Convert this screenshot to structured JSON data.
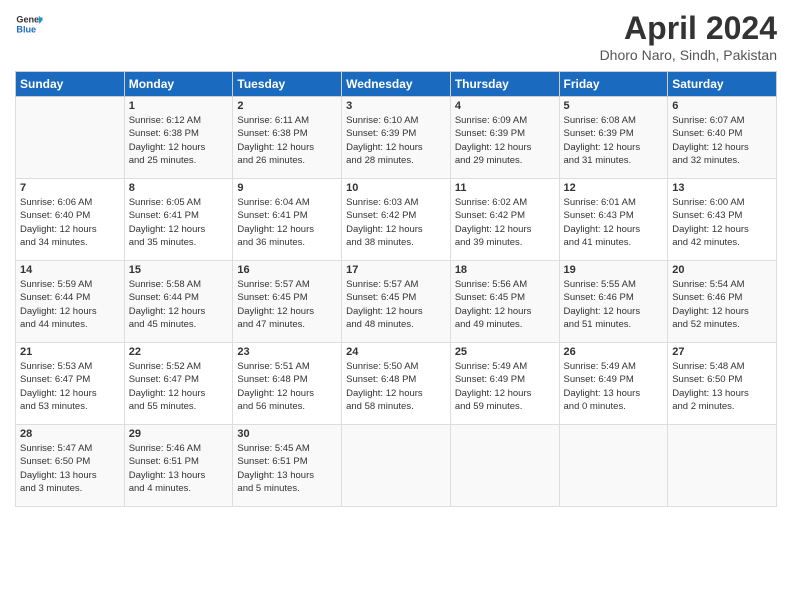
{
  "header": {
    "logo_line1": "General",
    "logo_line2": "Blue",
    "title": "April 2024",
    "location": "Dhoro Naro, Sindh, Pakistan"
  },
  "columns": [
    "Sunday",
    "Monday",
    "Tuesday",
    "Wednesday",
    "Thursday",
    "Friday",
    "Saturday"
  ],
  "rows": [
    [
      {
        "day": "",
        "info": ""
      },
      {
        "day": "1",
        "info": "Sunrise: 6:12 AM\nSunset: 6:38 PM\nDaylight: 12 hours\nand 25 minutes."
      },
      {
        "day": "2",
        "info": "Sunrise: 6:11 AM\nSunset: 6:38 PM\nDaylight: 12 hours\nand 26 minutes."
      },
      {
        "day": "3",
        "info": "Sunrise: 6:10 AM\nSunset: 6:39 PM\nDaylight: 12 hours\nand 28 minutes."
      },
      {
        "day": "4",
        "info": "Sunrise: 6:09 AM\nSunset: 6:39 PM\nDaylight: 12 hours\nand 29 minutes."
      },
      {
        "day": "5",
        "info": "Sunrise: 6:08 AM\nSunset: 6:39 PM\nDaylight: 12 hours\nand 31 minutes."
      },
      {
        "day": "6",
        "info": "Sunrise: 6:07 AM\nSunset: 6:40 PM\nDaylight: 12 hours\nand 32 minutes."
      }
    ],
    [
      {
        "day": "7",
        "info": "Sunrise: 6:06 AM\nSunset: 6:40 PM\nDaylight: 12 hours\nand 34 minutes."
      },
      {
        "day": "8",
        "info": "Sunrise: 6:05 AM\nSunset: 6:41 PM\nDaylight: 12 hours\nand 35 minutes."
      },
      {
        "day": "9",
        "info": "Sunrise: 6:04 AM\nSunset: 6:41 PM\nDaylight: 12 hours\nand 36 minutes."
      },
      {
        "day": "10",
        "info": "Sunrise: 6:03 AM\nSunset: 6:42 PM\nDaylight: 12 hours\nand 38 minutes."
      },
      {
        "day": "11",
        "info": "Sunrise: 6:02 AM\nSunset: 6:42 PM\nDaylight: 12 hours\nand 39 minutes."
      },
      {
        "day": "12",
        "info": "Sunrise: 6:01 AM\nSunset: 6:43 PM\nDaylight: 12 hours\nand 41 minutes."
      },
      {
        "day": "13",
        "info": "Sunrise: 6:00 AM\nSunset: 6:43 PM\nDaylight: 12 hours\nand 42 minutes."
      }
    ],
    [
      {
        "day": "14",
        "info": "Sunrise: 5:59 AM\nSunset: 6:44 PM\nDaylight: 12 hours\nand 44 minutes."
      },
      {
        "day": "15",
        "info": "Sunrise: 5:58 AM\nSunset: 6:44 PM\nDaylight: 12 hours\nand 45 minutes."
      },
      {
        "day": "16",
        "info": "Sunrise: 5:57 AM\nSunset: 6:45 PM\nDaylight: 12 hours\nand 47 minutes."
      },
      {
        "day": "17",
        "info": "Sunrise: 5:57 AM\nSunset: 6:45 PM\nDaylight: 12 hours\nand 48 minutes."
      },
      {
        "day": "18",
        "info": "Sunrise: 5:56 AM\nSunset: 6:45 PM\nDaylight: 12 hours\nand 49 minutes."
      },
      {
        "day": "19",
        "info": "Sunrise: 5:55 AM\nSunset: 6:46 PM\nDaylight: 12 hours\nand 51 minutes."
      },
      {
        "day": "20",
        "info": "Sunrise: 5:54 AM\nSunset: 6:46 PM\nDaylight: 12 hours\nand 52 minutes."
      }
    ],
    [
      {
        "day": "21",
        "info": "Sunrise: 5:53 AM\nSunset: 6:47 PM\nDaylight: 12 hours\nand 53 minutes."
      },
      {
        "day": "22",
        "info": "Sunrise: 5:52 AM\nSunset: 6:47 PM\nDaylight: 12 hours\nand 55 minutes."
      },
      {
        "day": "23",
        "info": "Sunrise: 5:51 AM\nSunset: 6:48 PM\nDaylight: 12 hours\nand 56 minutes."
      },
      {
        "day": "24",
        "info": "Sunrise: 5:50 AM\nSunset: 6:48 PM\nDaylight: 12 hours\nand 58 minutes."
      },
      {
        "day": "25",
        "info": "Sunrise: 5:49 AM\nSunset: 6:49 PM\nDaylight: 12 hours\nand 59 minutes."
      },
      {
        "day": "26",
        "info": "Sunrise: 5:49 AM\nSunset: 6:49 PM\nDaylight: 13 hours\nand 0 minutes."
      },
      {
        "day": "27",
        "info": "Sunrise: 5:48 AM\nSunset: 6:50 PM\nDaylight: 13 hours\nand 2 minutes."
      }
    ],
    [
      {
        "day": "28",
        "info": "Sunrise: 5:47 AM\nSunset: 6:50 PM\nDaylight: 13 hours\nand 3 minutes."
      },
      {
        "day": "29",
        "info": "Sunrise: 5:46 AM\nSunset: 6:51 PM\nDaylight: 13 hours\nand 4 minutes."
      },
      {
        "day": "30",
        "info": "Sunrise: 5:45 AM\nSunset: 6:51 PM\nDaylight: 13 hours\nand 5 minutes."
      },
      {
        "day": "",
        "info": ""
      },
      {
        "day": "",
        "info": ""
      },
      {
        "day": "",
        "info": ""
      },
      {
        "day": "",
        "info": ""
      }
    ]
  ]
}
